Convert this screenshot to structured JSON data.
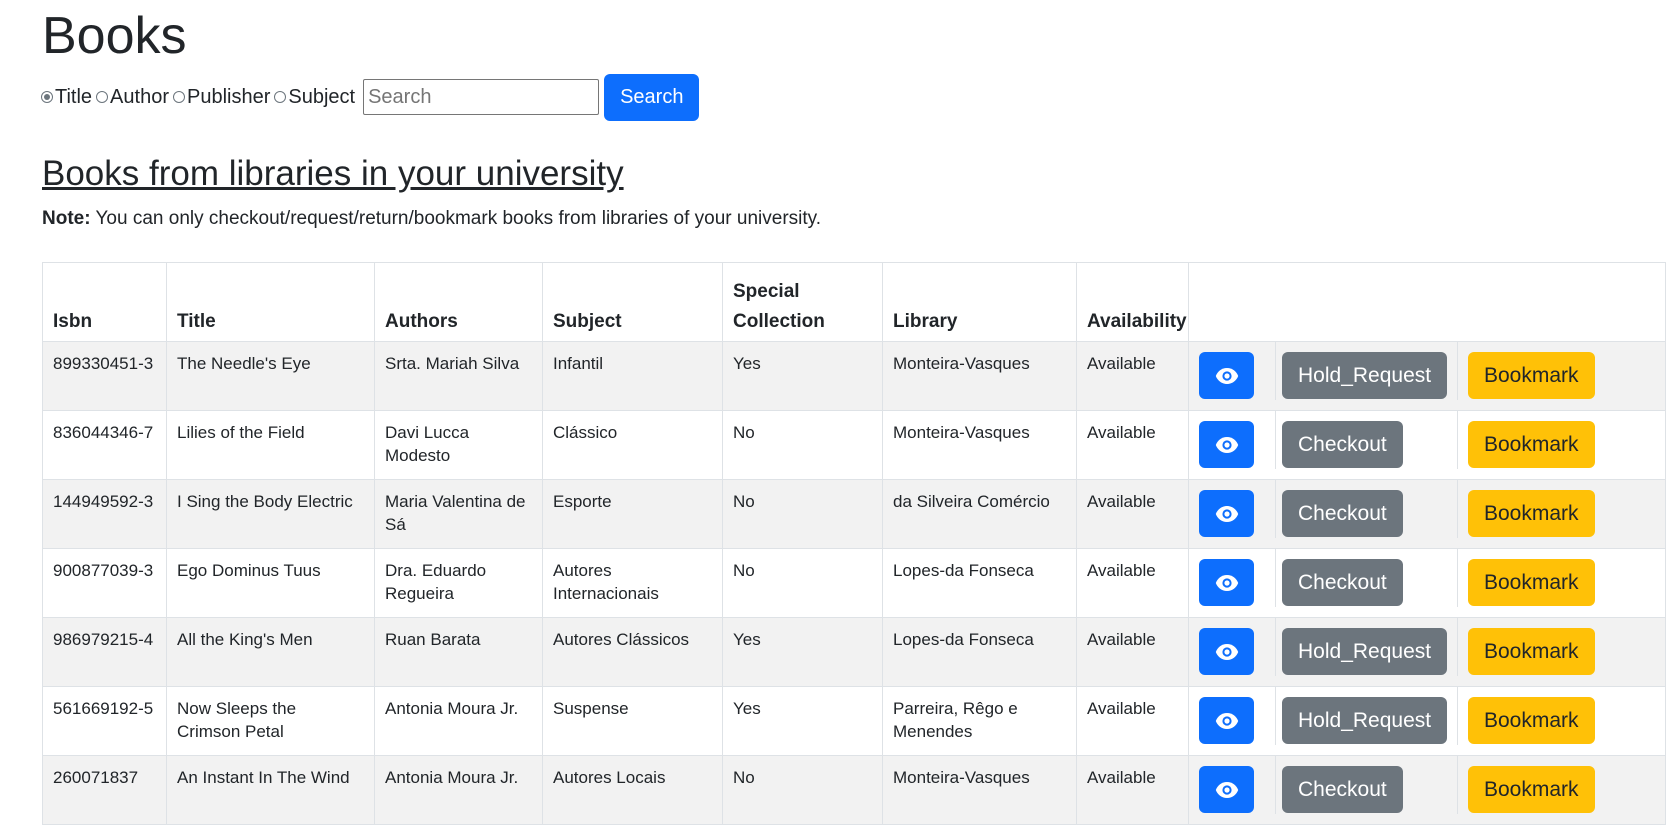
{
  "page": {
    "title": "Books"
  },
  "search": {
    "options": [
      {
        "label": "Title",
        "checked": true
      },
      {
        "label": "Author",
        "checked": false
      },
      {
        "label": "Publisher",
        "checked": false
      },
      {
        "label": "Subject",
        "checked": false
      }
    ],
    "placeholder": "Search",
    "value": "",
    "button_label": "Search"
  },
  "section": {
    "title": "Books from libraries in your university",
    "note_label": "Note:",
    "note_text": " You can only checkout/request/return/bookmark books from libraries of your university."
  },
  "table": {
    "headers": [
      "Isbn",
      "Title",
      "Authors",
      "Subject",
      "Special Collection",
      "Library",
      "Availability",
      ""
    ],
    "rows": [
      {
        "isbn": "899330451-3",
        "title": "The Needle's Eye",
        "authors": "Srta. Mariah Silva",
        "subject": "Infantil",
        "special": "Yes",
        "library": "Monteira-Vasques",
        "availability": "Available",
        "action": "Hold_Request",
        "bookmark": "Bookmark"
      },
      {
        "isbn": "836044346-7",
        "title": "Lilies of the Field",
        "authors": "Davi Lucca Modesto",
        "subject": "Clássico",
        "special": "No",
        "library": "Monteira-Vasques",
        "availability": "Available",
        "action": "Checkout",
        "bookmark": "Bookmark"
      },
      {
        "isbn": "144949592-3",
        "title": "I Sing the Body Electric",
        "authors": "Maria Valentina de Sá",
        "subject": "Esporte",
        "special": "No",
        "library": "da Silveira Comércio",
        "availability": "Available",
        "action": "Checkout",
        "bookmark": "Bookmark"
      },
      {
        "isbn": "900877039-3",
        "title": "Ego Dominus Tuus",
        "authors": "Dra. Eduardo Regueira",
        "subject": "Autores Internacionais",
        "special": "No",
        "library": "Lopes-da Fonseca",
        "availability": "Available",
        "action": "Checkout",
        "bookmark": "Bookmark"
      },
      {
        "isbn": "986979215-4",
        "title": "All the King's Men",
        "authors": "Ruan Barata",
        "subject": "Autores Clássicos",
        "special": "Yes",
        "library": "Lopes-da Fonseca",
        "availability": "Available",
        "action": "Hold_Request",
        "bookmark": "Bookmark"
      },
      {
        "isbn": "561669192-5",
        "title": "Now Sleeps the Crimson Petal",
        "authors": "Antonia Moura Jr.",
        "subject": "Suspense",
        "special": "Yes",
        "library": "Parreira, Rêgo e Menendes",
        "availability": "Available",
        "action": "Hold_Request",
        "bookmark": "Bookmark"
      },
      {
        "isbn": "260071837",
        "title": "An Instant In The Wind",
        "authors": "Antonia Moura Jr.",
        "subject": "Autores Locais",
        "special": "No",
        "library": "Monteira-Vasques",
        "availability": "Available",
        "action": "Checkout",
        "bookmark": "Bookmark"
      }
    ]
  },
  "icons": {
    "view": "eye-icon"
  },
  "colors": {
    "primary": "#0d6efd",
    "secondary": "#6c757d",
    "warning": "#ffc107"
  }
}
